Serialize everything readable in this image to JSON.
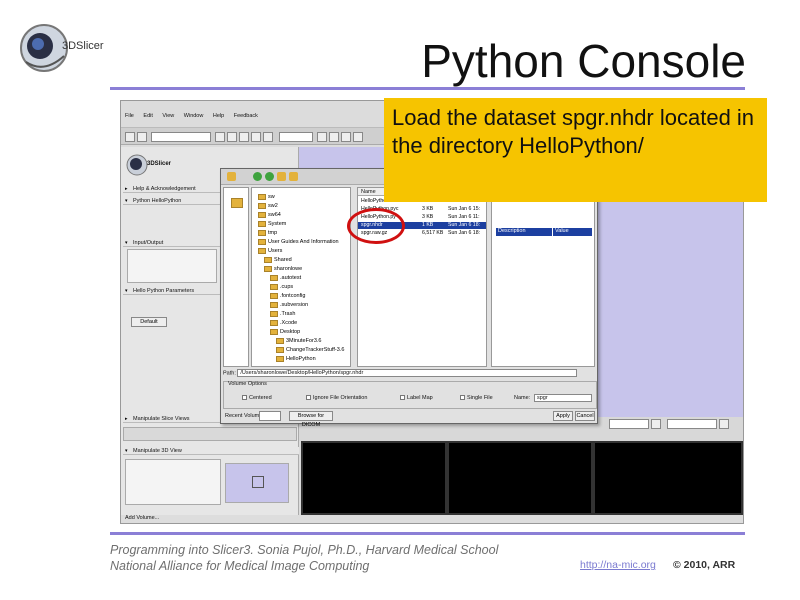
{
  "slide": {
    "title": "Python Console",
    "logo_text": "3DSlicer",
    "callout": "Load the dataset spgr.nhdr located in the directory HelloPython/",
    "footer_line1": "Programming into Slicer3. Sonia Pujol, Ph.D., Harvard Medical School",
    "footer_line2": "National Alliance for Medical Image Computing",
    "footer_link": "http://na-mic.org",
    "footer_copyright": "© 2010, ARR"
  },
  "app": {
    "menu": [
      "File",
      "Edit",
      "View",
      "Window",
      "Help",
      "Feedback"
    ],
    "logo_text": "3DSlicer",
    "sections": [
      "Help & Acknowledgement",
      "Python HelloPython",
      "Input/Output",
      "Hello Python Parameters",
      "Manipulate Slice Views",
      "Manipulate 3D View"
    ],
    "default_button": "Default",
    "status": "Add Volume..."
  },
  "dialog": {
    "tree": [
      "sw",
      "sw2",
      "sw64",
      "System",
      "tmp",
      "User Guides And Information",
      "Users",
      "Shared",
      "sharonlowe",
      ".autotest",
      ".cups",
      ".fontconfig",
      ".subversion",
      ".Trash",
      ".Xcode",
      "Desktop",
      "3MinuteFor3.6",
      "ChangeTrackerStuff-3.6",
      "HelloPython"
    ],
    "files_header": "Name",
    "files": [
      {
        "name": "HelloPytho",
        "size": "",
        "date": ""
      },
      {
        "name": "HelloPython.pyc",
        "size": "3 KB",
        "date": "Sun Jan 6 15:"
      },
      {
        "name": "HelloPython.py",
        "size": "3 KB",
        "date": "Sun Jan 6 11:"
      },
      {
        "name": "spgr.nhdr",
        "size": "1 KB",
        "date": "Sun Jan 6 18:"
      },
      {
        "name": "spgr.raw.gz",
        "size": "6,517 KB",
        "date": "Sun Jan 6 18:"
      }
    ],
    "props_header": [
      "Description",
      "Value"
    ],
    "path_label": "Path:",
    "path_value": "/Users/sharonlowe/Desktop/HelloPython/spgr.nhdr",
    "volume_options_label": "Volume Options",
    "options": [
      "Centered",
      "Ignore File Orientation",
      "Label Map",
      "Single File"
    ],
    "name_label": "Name:",
    "name_value": "spgr",
    "recent_label": "Recent Volumes:",
    "browse_button": "Browse for DICOM",
    "apply_button": "Apply",
    "cancel_button": "Cancel"
  }
}
